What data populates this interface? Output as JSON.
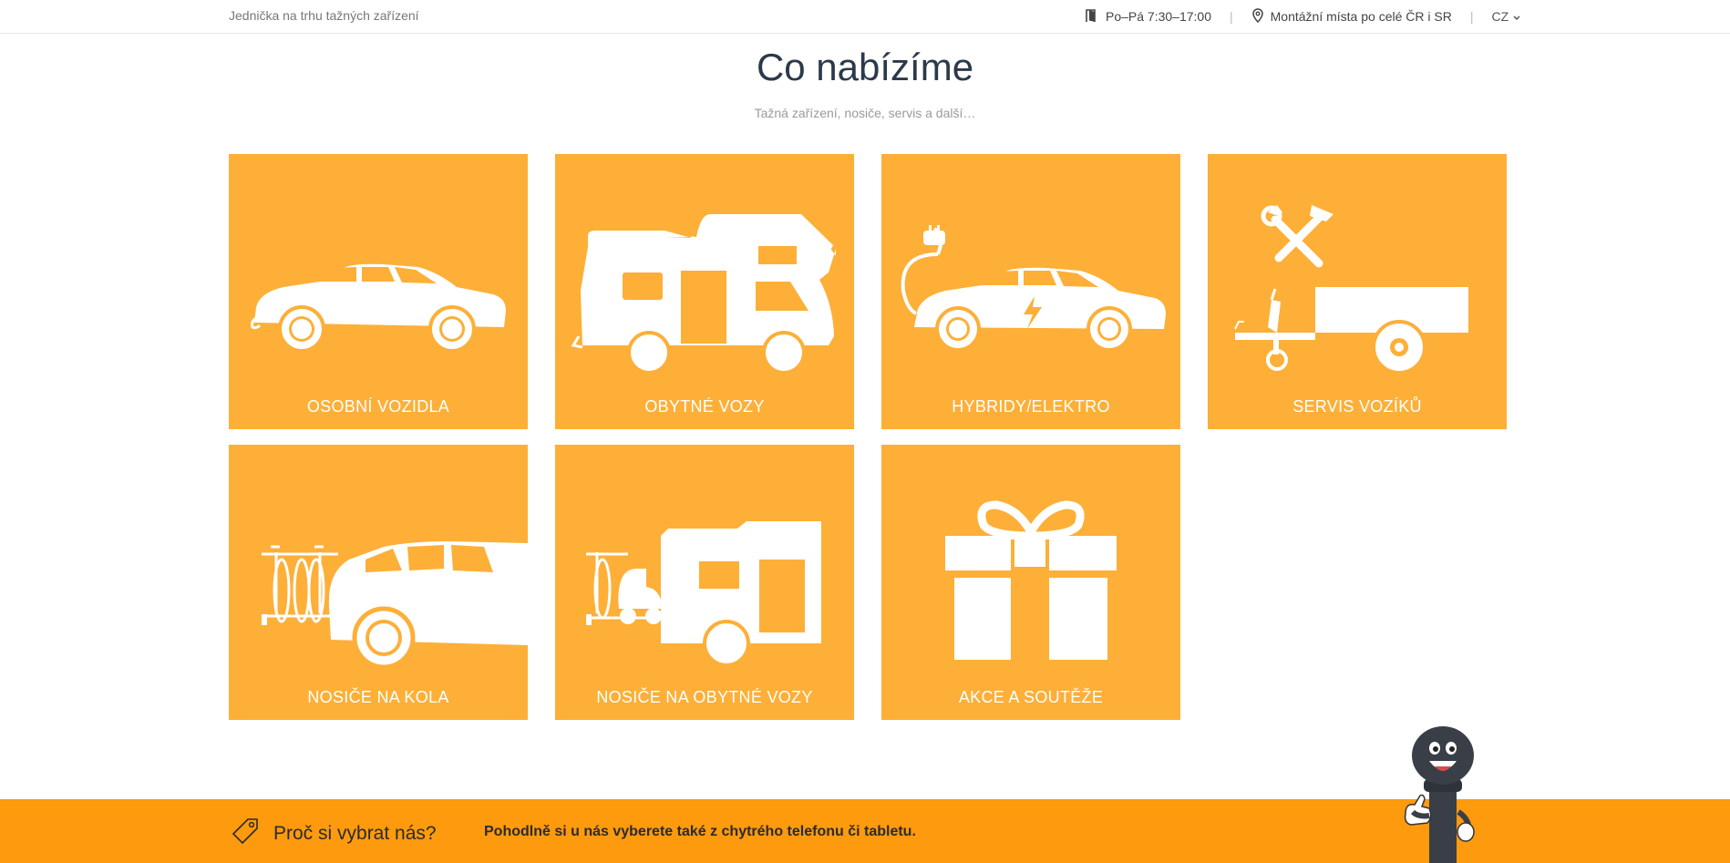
{
  "topbar": {
    "tagline": "Jednička na trhu tažných zařízení",
    "hours": "Po–Pá 7:30–17:00",
    "locations": "Montážní místa po celé ČR i SR",
    "language": "CZ"
  },
  "section": {
    "title": "Co nabízíme",
    "subtitle": "Tažná zařízení, nosiče, servis a další…"
  },
  "tiles": [
    {
      "label": "OSOBNÍ VOZIDLA",
      "icon": "car-icon"
    },
    {
      "label": "OBYTNÉ VOZY",
      "icon": "motorhome-icon"
    },
    {
      "label": "HYBRIDY/ELEKTRO",
      "icon": "electric-car-icon"
    },
    {
      "label": "SERVIS VOZÍKŮ",
      "icon": "trailer-service-icon"
    },
    {
      "label": "NOSIČE NA KOLA",
      "icon": "bike-carrier-icon"
    },
    {
      "label": "NOSIČE NA OBYTNÉ VOZY",
      "icon": "motorhome-carrier-icon"
    },
    {
      "label": "AKCE A SOUTĚŽE",
      "icon": "gift-icon"
    }
  ],
  "band": {
    "why_label": "Proč si vybrat nás?",
    "note": "Pohodlně si u nás vyberete také z chytrého telefonu či tabletu."
  },
  "colors": {
    "tile": "#fdaf38",
    "band": "#fd9a0e",
    "heading": "#2b3a4a"
  }
}
